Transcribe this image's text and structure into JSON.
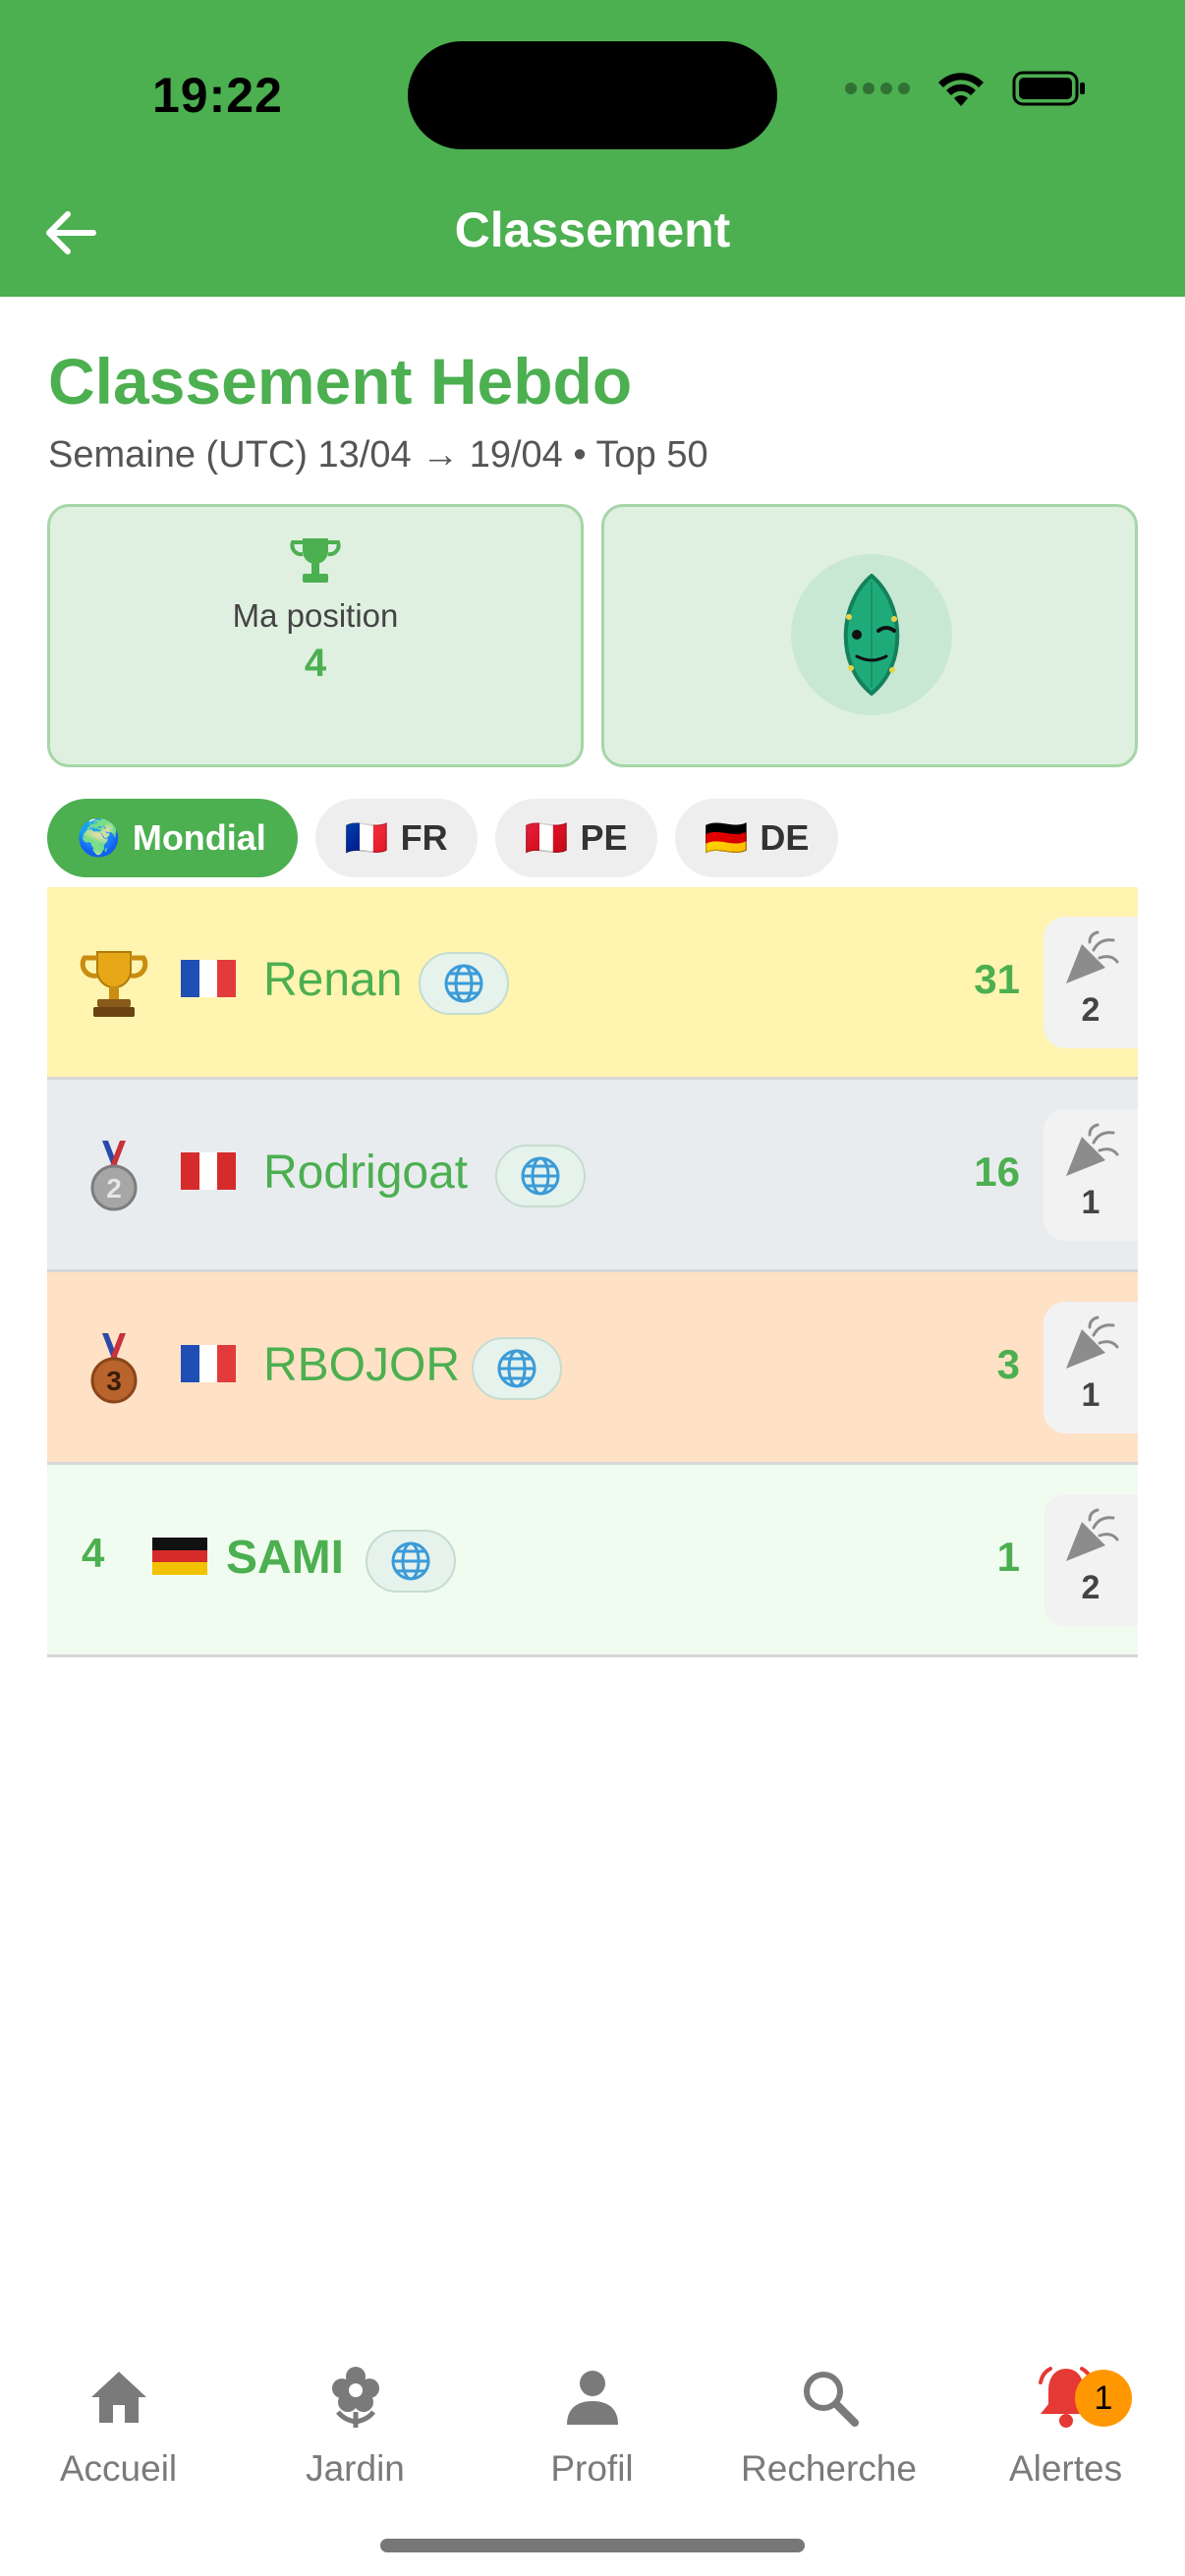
{
  "status_bar": {
    "time": "19:22"
  },
  "header": {
    "title": "Classement"
  },
  "page": {
    "title": "Classement Hebdo",
    "subtitle": "Semaine (UTC) 13/04 → 19/04 • Top 50"
  },
  "position_card": {
    "label": "Ma position",
    "value": "4"
  },
  "filters": [
    {
      "label": "Mondial",
      "flag": "🌍",
      "active": true
    },
    {
      "label": "FR",
      "flag": "🇫🇷",
      "active": false
    },
    {
      "label": "PE",
      "flag": "🇵🇪",
      "active": false
    },
    {
      "label": "DE",
      "flag": "🇩🇪",
      "active": false
    }
  ],
  "leaderboard": [
    {
      "rank": "1",
      "rank_icon": "trophy-icon",
      "flag": "🇫🇷",
      "name": "Renan",
      "score": "31",
      "cheers": "2"
    },
    {
      "rank": "2",
      "rank_icon": "silver-medal-icon",
      "flag": "🇵🇪",
      "name": "Rodrigoat",
      "score": "16",
      "cheers": "1"
    },
    {
      "rank": "3",
      "rank_icon": "bronze-medal-icon",
      "flag": "🇫🇷",
      "name": "RBOJOR",
      "score": "3",
      "cheers": "1"
    },
    {
      "rank": "4",
      "rank_icon": "",
      "flag": "🇩🇪",
      "name": "SAMI",
      "score": "1",
      "cheers": "2"
    }
  ],
  "tabs": [
    {
      "label": "Accueil",
      "icon": "home-icon"
    },
    {
      "label": "Jardin",
      "icon": "flower-icon"
    },
    {
      "label": "Profil",
      "icon": "person-icon"
    },
    {
      "label": "Recherche",
      "icon": "search-icon"
    },
    {
      "label": "Alertes",
      "icon": "bell-icon",
      "badge": "1"
    }
  ],
  "colors": {
    "primary": "#4caf50",
    "gold_row": "#fff4b0",
    "silver_row": "#e9ecef",
    "bronze_row": "#ffe1c6",
    "alert_red": "#e53935",
    "badge_orange": "#ff9800"
  }
}
